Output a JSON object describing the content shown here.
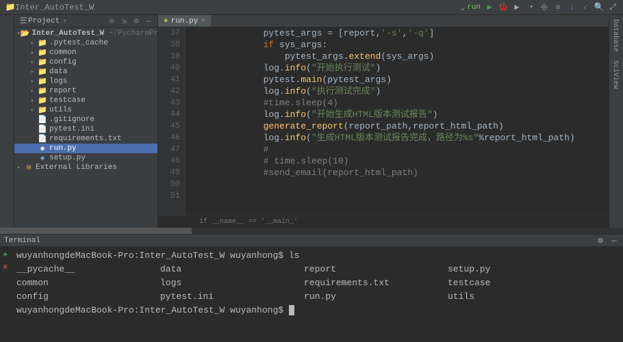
{
  "titlebar": {
    "project_name": "Inter_AutoTest_W"
  },
  "toolbar": {
    "run_label": "run"
  },
  "project_panel": {
    "title": "Project",
    "root": {
      "name": "Inter_AutoTest_W",
      "path": "~/PycharmProjects/Inter"
    },
    "items": [
      {
        "name": ".pytest_cache",
        "type": "folder",
        "indent": 2
      },
      {
        "name": "common",
        "type": "folder",
        "indent": 2
      },
      {
        "name": "config",
        "type": "folder",
        "indent": 2
      },
      {
        "name": "data",
        "type": "folder",
        "indent": 2
      },
      {
        "name": "logs",
        "type": "folder",
        "indent": 2
      },
      {
        "name": "report",
        "type": "folder",
        "indent": 2
      },
      {
        "name": "testcase",
        "type": "folder",
        "indent": 2
      },
      {
        "name": "utils",
        "type": "folder",
        "indent": 2
      },
      {
        "name": ".gitignore",
        "type": "file",
        "indent": 2
      },
      {
        "name": "pytest.ini",
        "type": "file",
        "indent": 2
      },
      {
        "name": "requirements.txt",
        "type": "file",
        "indent": 2
      },
      {
        "name": "run.py",
        "type": "pyfile",
        "indent": 2,
        "selected": true
      },
      {
        "name": "setup.py",
        "type": "pyfile",
        "indent": 2
      }
    ],
    "external": "External Libraries"
  },
  "editor": {
    "tab": {
      "name": "run.py"
    },
    "breadcrumb": "if __name__ == '__main_'",
    "lines": [
      {
        "n": 37,
        "tokens": [
          [
            "id",
            "            pytest_args "
          ],
          [
            "op",
            "= "
          ],
          [
            "op",
            "["
          ],
          [
            "id",
            "report"
          ],
          [
            "op",
            ","
          ],
          [
            "str",
            "'-s'"
          ],
          [
            "op",
            ","
          ],
          [
            "str",
            "'-q'"
          ],
          [
            "op",
            "]"
          ]
        ]
      },
      {
        "n": 38,
        "tokens": [
          [
            "id",
            "            "
          ],
          [
            "kw",
            "if "
          ],
          [
            "id",
            "sys_args"
          ],
          [
            "op",
            ":"
          ]
        ]
      },
      {
        "n": 39,
        "tokens": [
          [
            "id",
            "                pytest_args."
          ],
          [
            "fn",
            "extend"
          ],
          [
            "op",
            "("
          ],
          [
            "id",
            "sys_args"
          ],
          [
            "op",
            ")"
          ]
        ]
      },
      {
        "n": 40,
        "tokens": [
          [
            "id",
            "            log."
          ],
          [
            "fn",
            "info"
          ],
          [
            "op",
            "("
          ],
          [
            "str",
            "\"开始执行测试\""
          ],
          [
            "op",
            ")"
          ]
        ]
      },
      {
        "n": 41,
        "tokens": [
          [
            "id",
            "            pytest."
          ],
          [
            "fn",
            "main"
          ],
          [
            "op",
            "("
          ],
          [
            "id",
            "pytest_args"
          ],
          [
            "op",
            ")"
          ]
        ]
      },
      {
        "n": 42,
        "tokens": [
          [
            "id",
            "            log."
          ],
          [
            "fn",
            "info"
          ],
          [
            "op",
            "("
          ],
          [
            "str",
            "\"执行测试完成\""
          ],
          [
            "op",
            ")"
          ]
        ]
      },
      {
        "n": 43,
        "tokens": [
          [
            "id",
            "            "
          ],
          [
            "cmt",
            "#time.sleep(4)"
          ]
        ]
      },
      {
        "n": 44,
        "tokens": [
          [
            "id",
            "            log."
          ],
          [
            "fn",
            "info"
          ],
          [
            "op",
            "("
          ],
          [
            "str",
            "\"开始生成HTML版本测试报告\""
          ],
          [
            "op",
            ")"
          ]
        ]
      },
      {
        "n": 45,
        "tokens": [
          [
            "id",
            "            "
          ],
          [
            "fn",
            "generate_report"
          ],
          [
            "op",
            "("
          ],
          [
            "id",
            "report_path"
          ],
          [
            "op",
            ","
          ],
          [
            "id",
            "report_html_path"
          ],
          [
            "op",
            ")"
          ]
        ]
      },
      {
        "n": 46,
        "tokens": [
          [
            "id",
            "            log."
          ],
          [
            "fn",
            "info"
          ],
          [
            "op",
            "("
          ],
          [
            "str",
            "\"生成HTML版本测试报告完成，路径为%s\""
          ],
          [
            "op",
            "%"
          ],
          [
            "id",
            "report_html_path"
          ],
          [
            "op",
            ")"
          ]
        ]
      },
      {
        "n": 47,
        "tokens": [
          [
            "id",
            "            "
          ],
          [
            "cmt",
            "#"
          ]
        ]
      },
      {
        "n": 48,
        "tokens": [
          [
            "id",
            "            "
          ],
          [
            "cmt",
            "# time.sleep(10)"
          ]
        ]
      },
      {
        "n": 49,
        "tokens": [
          [
            "id",
            "            "
          ],
          [
            "cmt",
            "#send_email(report_html_path)"
          ]
        ]
      },
      {
        "n": 50,
        "tokens": []
      },
      {
        "n": 51,
        "tokens": []
      }
    ]
  },
  "terminal": {
    "title": "Terminal",
    "prompt1": "wuyanhongdeMacBook-Pro:Inter_AutoTest_W wuyanhong$ ",
    "cmd1": "ls",
    "ls": [
      [
        "__pycache__",
        "data",
        "report",
        "setup.py"
      ],
      [
        "common",
        "logs",
        "requirements.txt",
        "testcase"
      ],
      [
        "config",
        "pytest.ini",
        "run.py",
        "utils"
      ]
    ],
    "prompt2": "wuyanhongdeMacBook-Pro:Inter_AutoTest_W wuyanhong$ "
  },
  "right_tabs": {
    "database": "Database",
    "sciview": "SciView"
  }
}
